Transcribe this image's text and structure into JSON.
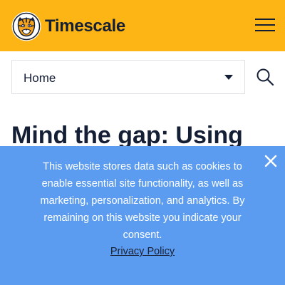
{
  "header": {
    "brand_name": "Timescale",
    "background_color": "#fdb515",
    "logo_icon": "tiger-head-icon",
    "menu_icon": "hamburger-menu-icon"
  },
  "nav": {
    "select_value": "Home",
    "select_icon": "caret-down-icon",
    "search_icon": "search-icon"
  },
  "article": {
    "title": "Mind the gap: Using"
  },
  "cookie_banner": {
    "message": "This website stores data such as cookies to enable essential site functionality, as well as marketing, personalization, and analytics. By remaining on this website you indicate your consent.",
    "link_label": "Privacy Policy",
    "close_icon": "close-icon",
    "background_color": "#5b9cf1"
  }
}
